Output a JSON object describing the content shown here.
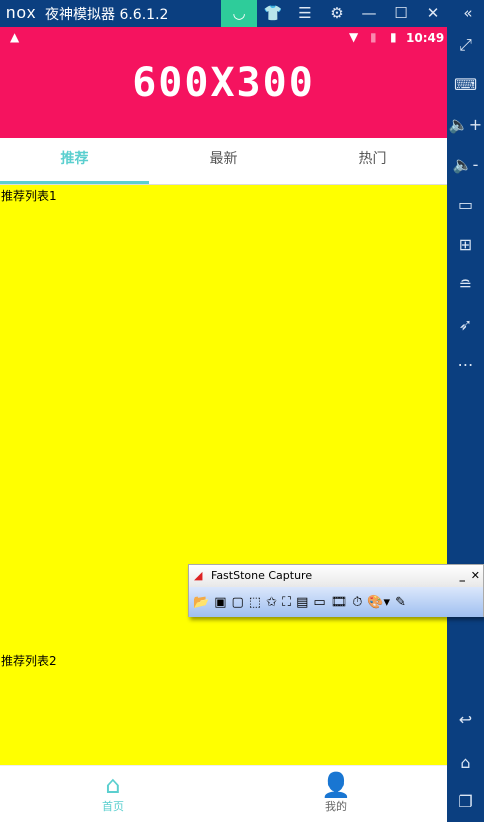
{
  "emulator": {
    "logo": "nox",
    "title": "夜神模拟器 6.6.1.2",
    "controls": [
      "store",
      "skin",
      "menu",
      "settings",
      "minimize",
      "maximize",
      "close",
      "collapse"
    ]
  },
  "sidebar": {
    "icons": [
      "fullscreen-icon",
      "keyboard-icon",
      "volume-up-icon",
      "volume-down-icon",
      "screen-icon",
      "apk-install-icon",
      "multi-instance-icon",
      "rocket-icon",
      "more-icon",
      "back-icon",
      "home-icon",
      "recents-icon"
    ]
  },
  "status": {
    "time": "10:49"
  },
  "banner": {
    "text": "600X300"
  },
  "tabs": [
    {
      "label": "推荐",
      "active": true
    },
    {
      "label": "最新"
    },
    {
      "label": "热门"
    }
  ],
  "list": [
    "推荐列表1",
    "推荐列表2"
  ],
  "bottom_nav": [
    {
      "label": "首页",
      "active": true
    },
    {
      "label": "我的"
    }
  ],
  "faststone": {
    "title": "FastStone Capture"
  },
  "colors": {
    "accent": "#5bcfcf",
    "banner": "#f5135f",
    "content": "#ffff00",
    "frame": "#0b3f80"
  }
}
